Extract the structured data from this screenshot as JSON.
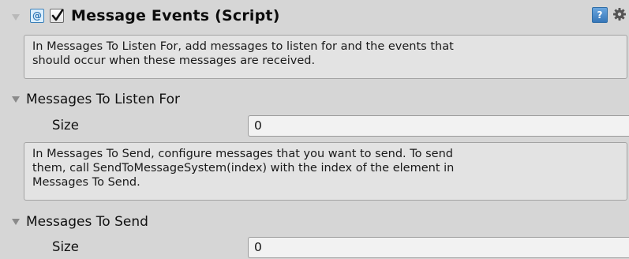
{
  "component": {
    "title": "Message Events (Script)",
    "enabled": true,
    "icons": [
      "script-icon",
      "enabled-checkbox",
      "help-icon",
      "gear-icon"
    ]
  },
  "info_listen": {
    "line1": "In Messages To Listen For, add messages to listen for and the events that",
    "line2": "should occur when these messages are received."
  },
  "listen_section": {
    "label": "Messages To Listen For",
    "size_label": "Size",
    "size_value": "0"
  },
  "info_send": {
    "line1": "In Messages To Send, configure messages that you want to send. To send",
    "line2": "them, call SendToMessageSystem(index) with the index of the element in",
    "line3": "Messages To Send."
  },
  "send_section": {
    "label": "Messages To Send",
    "size_label": "Size",
    "size_value": "0"
  },
  "colors": {
    "background": "#d6d6d6",
    "infobox": "#e3e3e3",
    "field": "#f2f2f2",
    "help_icon": "#3777b9"
  }
}
